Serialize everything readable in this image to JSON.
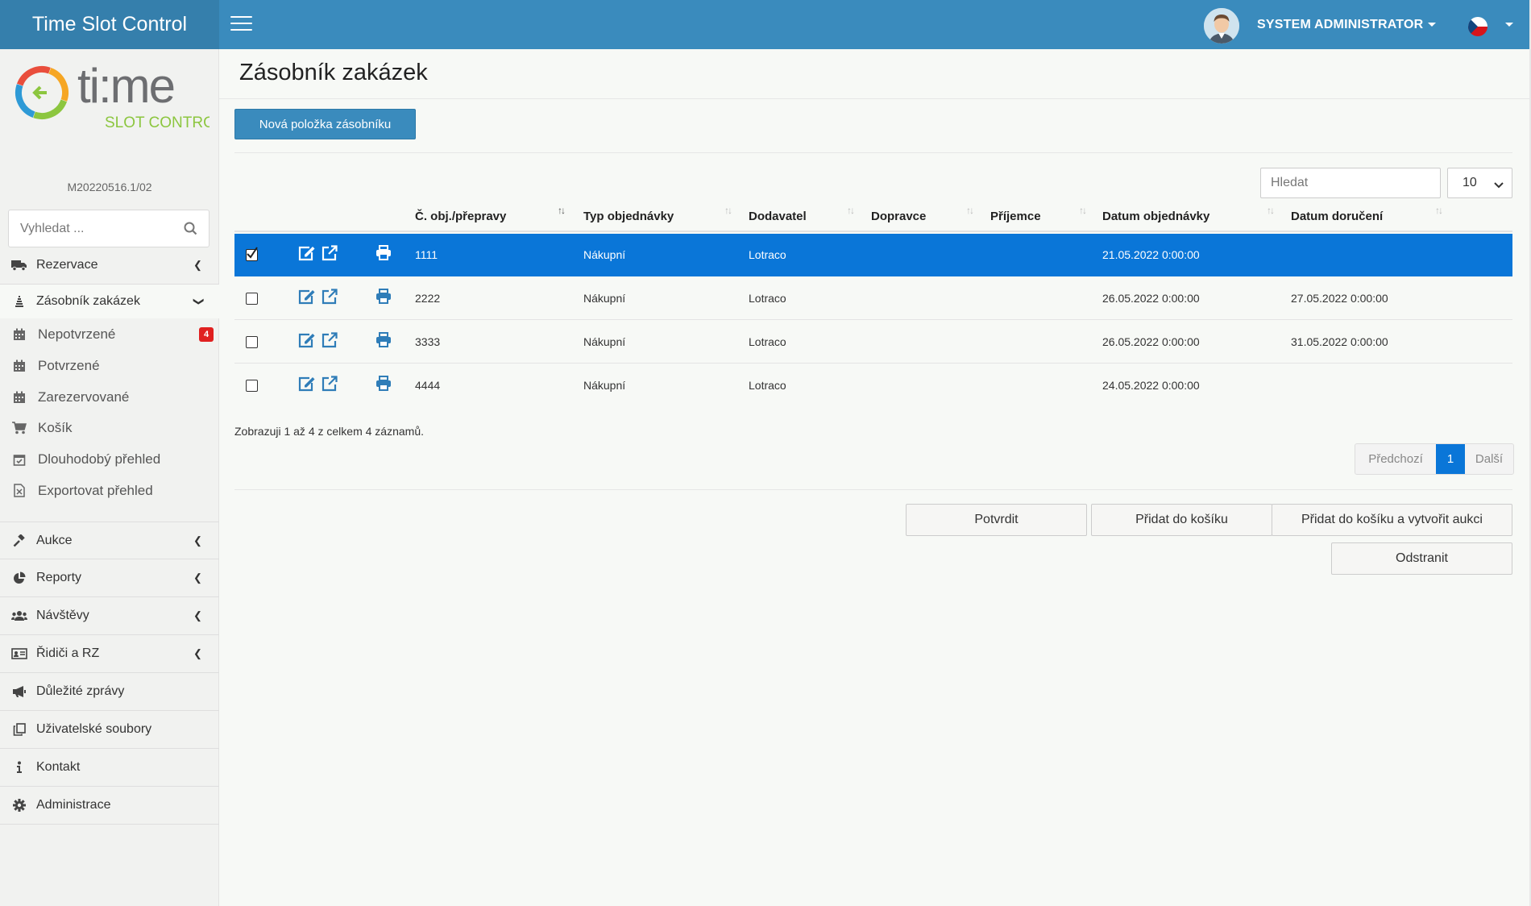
{
  "app": {
    "title": "Time Slot Control",
    "version": "M20220516.1/02"
  },
  "user": {
    "name": "SYSTEM ADMINISTRATOR",
    "language_flag": "cz-flag"
  },
  "logo": {
    "word": "ti:me",
    "tagline": "SLOT CONTROL"
  },
  "sidebar": {
    "search_placeholder": "Vyhledat ...",
    "items": [
      {
        "label": "Rezervace",
        "icon": "truck-icon"
      },
      {
        "label": "Zásobník zakázek",
        "icon": "stack-icon"
      },
      {
        "label": "Nepotvrzené",
        "icon": "calendar-icon",
        "badge": "4"
      },
      {
        "label": "Potvrzené",
        "icon": "calendar-icon"
      },
      {
        "label": "Zarezervované",
        "icon": "calendar-icon"
      },
      {
        "label": "Košík",
        "icon": "cart-icon"
      },
      {
        "label": "Dlouhodobý přehled",
        "icon": "calendar-check-icon"
      },
      {
        "label": "Exportovat přehled",
        "icon": "excel-file-icon"
      },
      {
        "label": "Aukce",
        "icon": "gavel-icon"
      },
      {
        "label": "Reporty",
        "icon": "pie-chart-icon"
      },
      {
        "label": "Návštěvy",
        "icon": "users-icon"
      },
      {
        "label": "Řidiči a RZ",
        "icon": "id-card-icon"
      },
      {
        "label": "Důležité zprávy",
        "icon": "megaphone-icon"
      },
      {
        "label": "Uživatelské soubory",
        "icon": "files-icon"
      },
      {
        "label": "Kontakt",
        "icon": "info-icon"
      },
      {
        "label": "Administrace",
        "icon": "gear-icon"
      }
    ]
  },
  "main": {
    "title": "Zásobník zakázek",
    "new_button": "Nová položka zásobníku",
    "search_placeholder": "Hledat",
    "page_size": "10",
    "columns": [
      "Č. obj./přepravy",
      "Typ objednávky",
      "Dodavatel",
      "Dopravce",
      "Příjemce",
      "Datum objednávky",
      "Datum doručení"
    ],
    "rows": [
      {
        "selected": true,
        "number": "1111",
        "type": "Nákupní",
        "supplier": "Lotraco",
        "carrier": "",
        "recipient": "",
        "order_date": "21.05.2022 0:00:00",
        "delivery_date": ""
      },
      {
        "selected": false,
        "number": "2222",
        "type": "Nákupní",
        "supplier": "Lotraco",
        "carrier": "",
        "recipient": "",
        "order_date": "26.05.2022 0:00:00",
        "delivery_date": "27.05.2022 0:00:00"
      },
      {
        "selected": false,
        "number": "3333",
        "type": "Nákupní",
        "supplier": "Lotraco",
        "carrier": "",
        "recipient": "",
        "order_date": "26.05.2022 0:00:00",
        "delivery_date": "31.05.2022 0:00:00"
      },
      {
        "selected": false,
        "number": "4444",
        "type": "Nákupní",
        "supplier": "Lotraco",
        "carrier": "",
        "recipient": "",
        "order_date": "24.05.2022 0:00:00",
        "delivery_date": ""
      }
    ],
    "info": "Zobrazuji 1 až 4 z celkem 4 záznamů.",
    "pager": {
      "prev": "Předchozí",
      "current": "1",
      "next": "Další"
    },
    "actions": {
      "confirm": "Potvrdit",
      "add_cart": "Přidat do košíku",
      "add_cart_auction": "Přidat do košíku a vytvořit aukci",
      "remove": "Odstranit"
    }
  },
  "colors": {
    "header": "#3a8bbd",
    "header_brand": "#357fac",
    "selection": "#0a76d8",
    "badge": "#e02020"
  }
}
